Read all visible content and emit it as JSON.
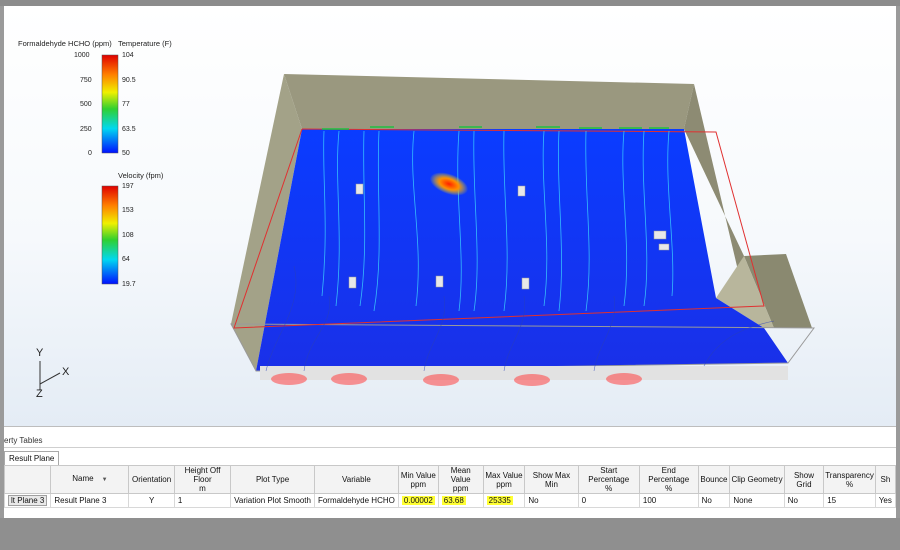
{
  "legend": {
    "hcho": {
      "title": "Formaldehyde HCHO (ppm)",
      "ticks": [
        "1000",
        "750",
        "500",
        "250",
        "0"
      ]
    },
    "temperature": {
      "title": "Temperature (F)",
      "ticks": [
        "104",
        "90.5",
        "77",
        "63.5",
        "50"
      ]
    },
    "velocity": {
      "title": "Velocity (fpm)",
      "ticks": [
        "197",
        "153",
        "108",
        "64",
        "19.7"
      ]
    }
  },
  "axes": {
    "y": "Y",
    "x": "X",
    "z": "Z"
  },
  "panel": {
    "title": "erty Tables",
    "tab": "Result Plane",
    "columns": [
      "",
      "Name",
      "Orientation",
      "Height Off Floor\nm",
      "Plot Type",
      "Variable",
      "Min Value\nppm",
      "Mean Value\nppm",
      "Max Value\nppm",
      "Show Max Min",
      "Start Percentage\n%",
      "End Percentage\n%",
      "Bounce",
      "Clip Geometry",
      "Show Grid",
      "Transparency\n%",
      "Sh"
    ],
    "row": {
      "selector": "lt Plane 3",
      "name": "Result Plane 3",
      "orientation": "Y",
      "height": "1",
      "plot_type": "Variation Plot Smooth",
      "variable": "Formaldehyde HCHO",
      "min": "0.00002",
      "mean": "63.68",
      "max": "25335",
      "show_max_min": "No",
      "start_pct": "0",
      "end_pct": "100",
      "bounce": "No",
      "clip_geometry": "None",
      "show_grid": "No",
      "transparency": "15",
      "sh": "Yes"
    }
  },
  "colors": {
    "floor": "#0a2cf0",
    "wall": "#8f8d76",
    "selection": "#e03030",
    "highlight": "#ffff33"
  }
}
